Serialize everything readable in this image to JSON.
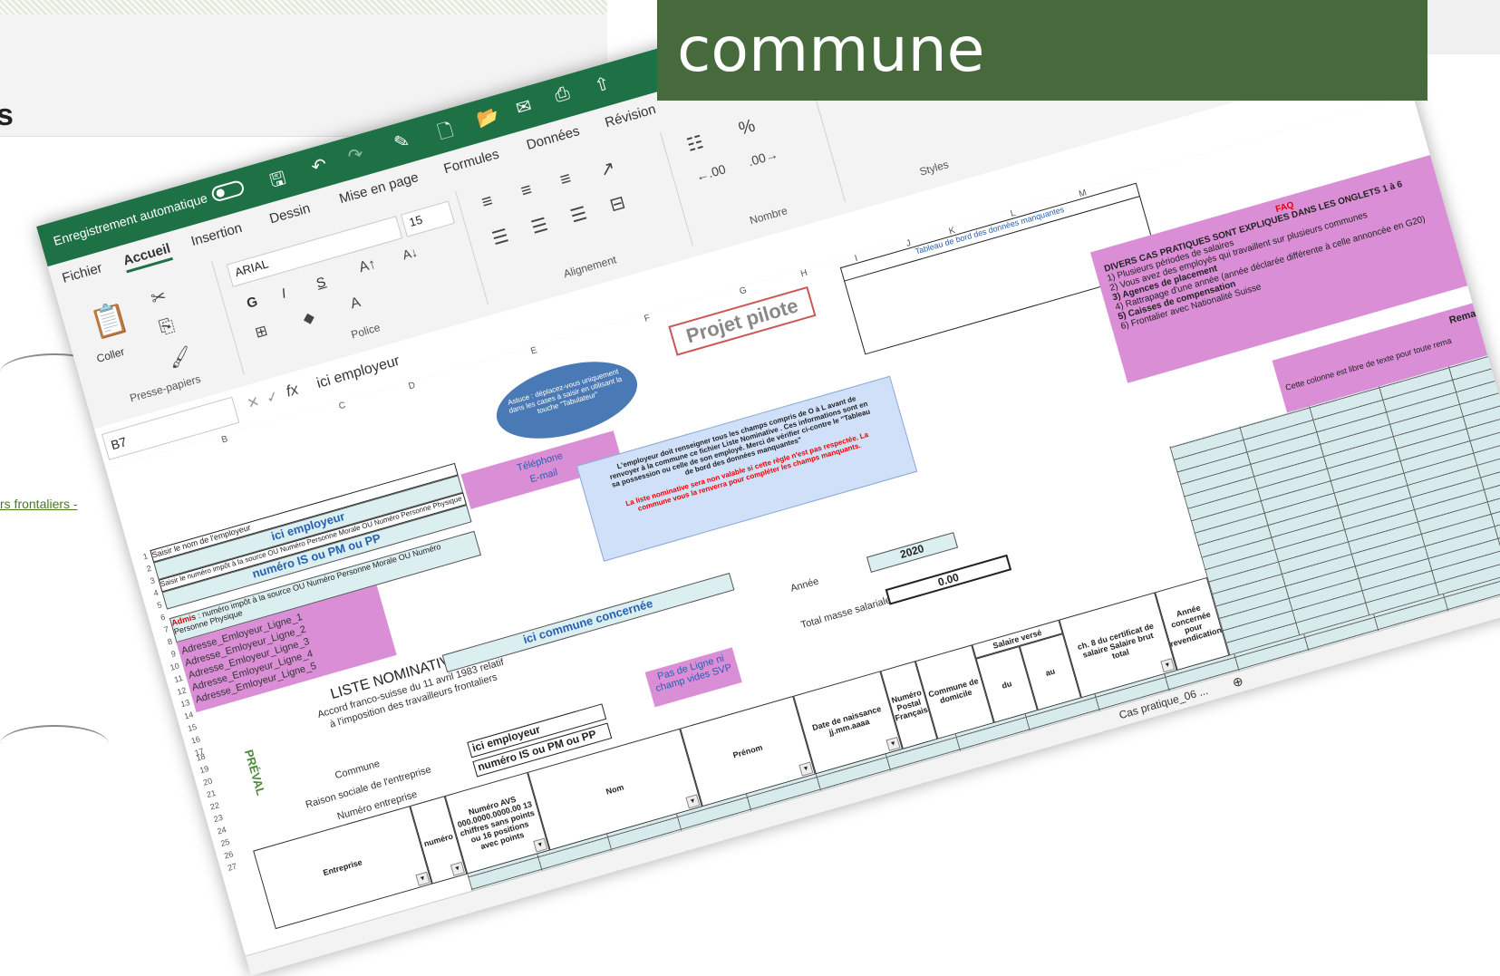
{
  "background": {
    "heading": "s",
    "link": "rs frontaliers -"
  },
  "banner": {
    "text": "commune"
  },
  "excel": {
    "autosave": "Enregistrement automatique",
    "tabs": [
      "Fichier",
      "Accueil",
      "Insertion",
      "Dessin",
      "Mise en page",
      "Formules",
      "Données",
      "Révision"
    ],
    "ribbon": {
      "coller": "Coller",
      "presse_papiers": "Presse-papiers",
      "font_name": "ARIAL",
      "font_size": "15",
      "bold": "G",
      "italic": "I",
      "underline": "S",
      "police": "Police",
      "alignement": "Alignement",
      "nombre": "Nombre",
      "styles": "Styles"
    },
    "formula": {
      "namebox": "B7",
      "fx": "fx",
      "value": "ici employeur"
    },
    "columns": [
      "B",
      "C",
      "D",
      "E",
      "F",
      "G",
      "H",
      "I",
      "J",
      "K",
      "L",
      "M"
    ],
    "rows": [
      "1",
      "2",
      "3",
      "4",
      "5",
      "6",
      "7",
      "8",
      "9",
      "10",
      "11",
      "12",
      "13",
      "14",
      "15",
      "16",
      "17",
      "18",
      "19",
      "20",
      "21",
      "22",
      "23",
      "24",
      "25",
      "26",
      "27"
    ],
    "sheet": {
      "saisir_nom": "Saisir le nom de l'employeur",
      "ici_employeur": "ici employeur",
      "ident_hint": "Saisir le numéro impôt à la source OU Numéro Personne Morale OU Numéro Personne Physique",
      "numero_is": "numéro IS ou PM ou PP",
      "admis_prefix": "Admis",
      "admis_hint": " : numéro impôt à la source OU Numéro Personne Morale OU Numéro Personne Physique",
      "adresses": [
        "Adresse_Emloyeur_Ligne_1",
        "Adresse_Emloyeur_Ligne_2",
        "Adresse_Emloyeur_Ligne_3",
        "Adresse_Emloyeur_Ligne_4",
        "Adresse_Emloyeur_Ligne_5"
      ],
      "telephone": "Téléphone",
      "email": "E-mail",
      "liste_title": "LISTE NOMINATIVE",
      "accord_1": "Accord franco-suisse du 11 avril 1983 relatif",
      "accord_2": "à l'imposition des travailleurs frontaliers",
      "ici_commune": "ici commune concernée",
      "commune_label": "Commune",
      "raison_label": "Raison sociale de l'entreprise",
      "numero_entreprise_label": "Numéro entreprise",
      "commune_val": "ici employeur",
      "numero_entreprise_val": "numéro IS ou PM ou PP",
      "pas_de_ligne": "Pas de Ligne ni champ vides SVP",
      "annee_label": "Année",
      "annee_val": "2020",
      "masse_label": "Total masse salariale",
      "masse_val": "0.00",
      "projet_pilote": "Projet pilote",
      "tableau_bord": "Tableau de bord des données manquantes",
      "astuce": "Astuce : déplacez-vous uniquement dans les cases à saisir en utilisant la touche \"Tabulateur\"",
      "ribbon_text_1": "L'employeur doit renseigner tous les champs compris de O à L avant de renvoyer à la commune ce fichier Liste Nominative . Ces informations sont en sa possession ou celle de son employé. Merci de vérifier ci-contre le \"Tableau de bord des données manquantes\"",
      "ribbon_text_2": "La liste nominative sera non valable si cette règle n'est pas respectée. La commune vous la renverra pour compléter les champs manquants.",
      "faq_title": "FAQ",
      "faq_sub": "DIVERS CAS PRATIQUES  SONT EXPLIQUES DANS LES ONGLETS 1 à 6",
      "faq_items": [
        "1) Plusieurs périodes de salaires",
        "2) Vous avez des employés  qui travaillent sur plusieurs communes",
        "3) Agences de placement",
        "4) Rattrapage d'une année (année déclarée différente à celle  annoncée en G20)",
        "5) Caisses de compensation",
        "6) Frontalier avec Nationalité Suisse"
      ],
      "remarque": "Remarque",
      "remarque_hint": "Cette colonne est libre de texte pour toute rema",
      "headers": {
        "entreprise": "Entreprise",
        "numero": "numéro",
        "avs": "Numéro AVS 000.0000.0000.00 13 chiffres sans points ou 16 positions avec points",
        "nom": "Nom",
        "prenom": "Prénom",
        "naissance": "Date de naissance jj.mm.aaaa",
        "npa": "Numéro Postal Français",
        "domicile": "Commune de domicile",
        "salaire_verse": "Salaire versé",
        "du": "du",
        "au": "au",
        "brut": "ch. 8 du certificat de salaire Salaire brut total",
        "revendication": "Année concernée pour revendication"
      },
      "logo": "PRÉVAL"
    },
    "sheet_tab": "Cas pratique_06 ..."
  }
}
